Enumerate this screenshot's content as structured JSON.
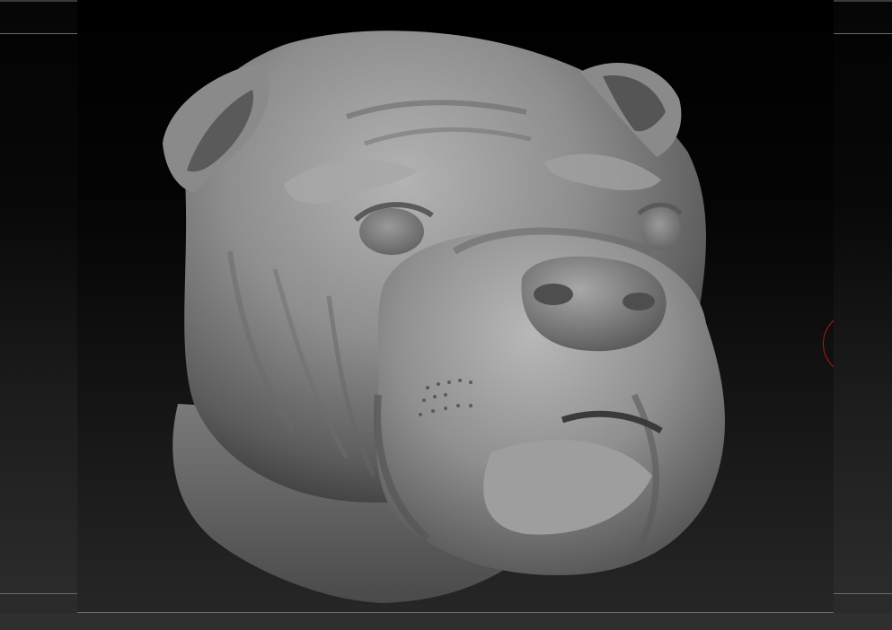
{
  "viewport": {
    "model_name": "bulldog-head-sculpt",
    "material_color": "#8c8c8c",
    "background_top": "#000000",
    "background_bottom": "#2a2a2a",
    "gizmo_color": "#b01818"
  }
}
